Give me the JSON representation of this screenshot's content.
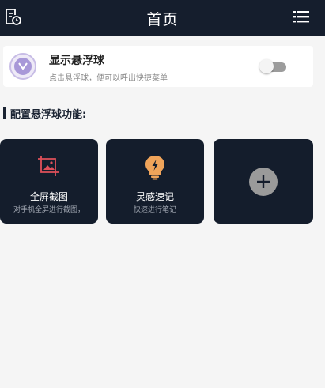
{
  "header": {
    "title": "首页",
    "left_icon": "document-history-icon",
    "right_icon": "list-menu-icon"
  },
  "floating_ball": {
    "title": "显示悬浮球",
    "description": "点击悬浮球，便可以呼出快捷菜单",
    "enabled": false,
    "icon": "floating-ball-logo-icon"
  },
  "section": {
    "title": "配置悬浮球功能:"
  },
  "functions": [
    {
      "label": "全屏截图",
      "description": "对手机全屏进行截图，",
      "icon": "screenshot-crop-icon",
      "icon_color": "#e0505a"
    },
    {
      "label": "灵感速记",
      "description": "快速进行笔记",
      "icon": "lightbulb-icon",
      "icon_color": "#f0a45a"
    },
    {
      "label": "",
      "description": "",
      "icon": "add-icon"
    }
  ],
  "colors": {
    "header_bg": "#151e2d",
    "tile_bg": "#141d2c",
    "page_bg": "#f5f5f5",
    "accent_purple": "#a898d8"
  }
}
